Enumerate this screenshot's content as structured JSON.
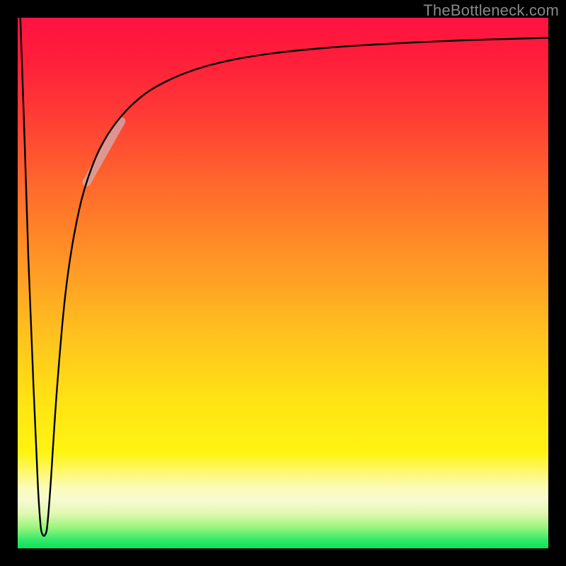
{
  "watermark": "TheBottleneck.com",
  "chart_data": {
    "type": "line",
    "title": "",
    "xlabel": "",
    "ylabel": "",
    "xlim": [
      0,
      100
    ],
    "ylim": [
      0,
      100
    ],
    "grid": false,
    "notes": "Axes unlabeled in source image; values are percent of plot width/height where y=0 is bottom and y=100 is top.",
    "gradient_stops": [
      {
        "pos": 0,
        "color": "#ff1240"
      },
      {
        "pos": 8,
        "color": "#ff1f3a"
      },
      {
        "pos": 18,
        "color": "#ff3a36"
      },
      {
        "pos": 32,
        "color": "#ff6a2c"
      },
      {
        "pos": 46,
        "color": "#ff9626"
      },
      {
        "pos": 60,
        "color": "#ffc21e"
      },
      {
        "pos": 72,
        "color": "#ffe314"
      },
      {
        "pos": 82,
        "color": "#fff412"
      },
      {
        "pos": 88.5,
        "color": "#fcfbb8"
      },
      {
        "pos": 91,
        "color": "#f7f9d0"
      },
      {
        "pos": 93.5,
        "color": "#e0f8b0"
      },
      {
        "pos": 96,
        "color": "#9cf57e"
      },
      {
        "pos": 98.5,
        "color": "#2fe968"
      },
      {
        "pos": 100,
        "color": "#0be35b"
      }
    ],
    "series": [
      {
        "name": "bottleneck-curve",
        "color": "#000000",
        "points": [
          {
            "x": 0.5,
            "y": 100.0
          },
          {
            "x": 1.2,
            "y": 80.0
          },
          {
            "x": 2.0,
            "y": 55.0
          },
          {
            "x": 3.0,
            "y": 30.0
          },
          {
            "x": 3.8,
            "y": 12.0
          },
          {
            "x": 4.3,
            "y": 4.5
          },
          {
            "x": 4.7,
            "y": 2.6
          },
          {
            "x": 5.2,
            "y": 2.6
          },
          {
            "x": 5.6,
            "y": 4.5
          },
          {
            "x": 6.2,
            "y": 12.0
          },
          {
            "x": 7.4,
            "y": 30.0
          },
          {
            "x": 9.0,
            "y": 48.0
          },
          {
            "x": 11.0,
            "y": 61.0
          },
          {
            "x": 13.5,
            "y": 70.5
          },
          {
            "x": 17.0,
            "y": 78.0
          },
          {
            "x": 22.0,
            "y": 84.0
          },
          {
            "x": 28.0,
            "y": 88.0
          },
          {
            "x": 36.0,
            "y": 91.0
          },
          {
            "x": 46.0,
            "y": 93.0
          },
          {
            "x": 58.0,
            "y": 94.3
          },
          {
            "x": 72.0,
            "y": 95.2
          },
          {
            "x": 86.0,
            "y": 95.8
          },
          {
            "x": 100.0,
            "y": 96.2
          }
        ]
      },
      {
        "name": "highlight-segment",
        "color": "rgba(212,170,170,0.78)",
        "points": [
          {
            "x": 13.0,
            "y": 69.0
          },
          {
            "x": 19.5,
            "y": 80.5
          }
        ]
      }
    ]
  }
}
